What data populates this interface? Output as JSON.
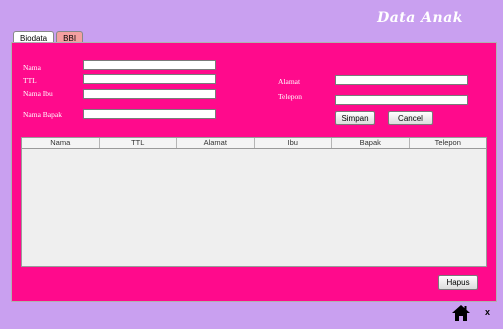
{
  "header": {
    "title": "Data Anak"
  },
  "tabs": [
    {
      "label": "Biodata",
      "active": true
    },
    {
      "label": "BBI",
      "active": false
    }
  ],
  "form": {
    "nama_label": "Nama",
    "ttl_label": "TTL",
    "nama_ibu_label": "Nama Ibu",
    "nama_bapak_label": "Nama Bapak",
    "alamat_label": "Alamat",
    "telepon_label": "Telepon",
    "nama_value": "",
    "ttl_value": "",
    "nama_ibu_value": "",
    "nama_bapak_value": "",
    "alamat_value": "",
    "telepon_value": ""
  },
  "buttons": {
    "simpan": "Simpan",
    "cancel": "Cancel",
    "hapus": "Hapus"
  },
  "table": {
    "columns": [
      "Nama",
      "TTL",
      "Alamat",
      "Ibu",
      "Bapak",
      "Telepon"
    ],
    "rows": []
  },
  "footer": {
    "close_label": "x"
  },
  "colors": {
    "panel": "#ff0a8c",
    "background": "#c9a0f0"
  },
  "icons": {
    "home": "home-icon"
  }
}
